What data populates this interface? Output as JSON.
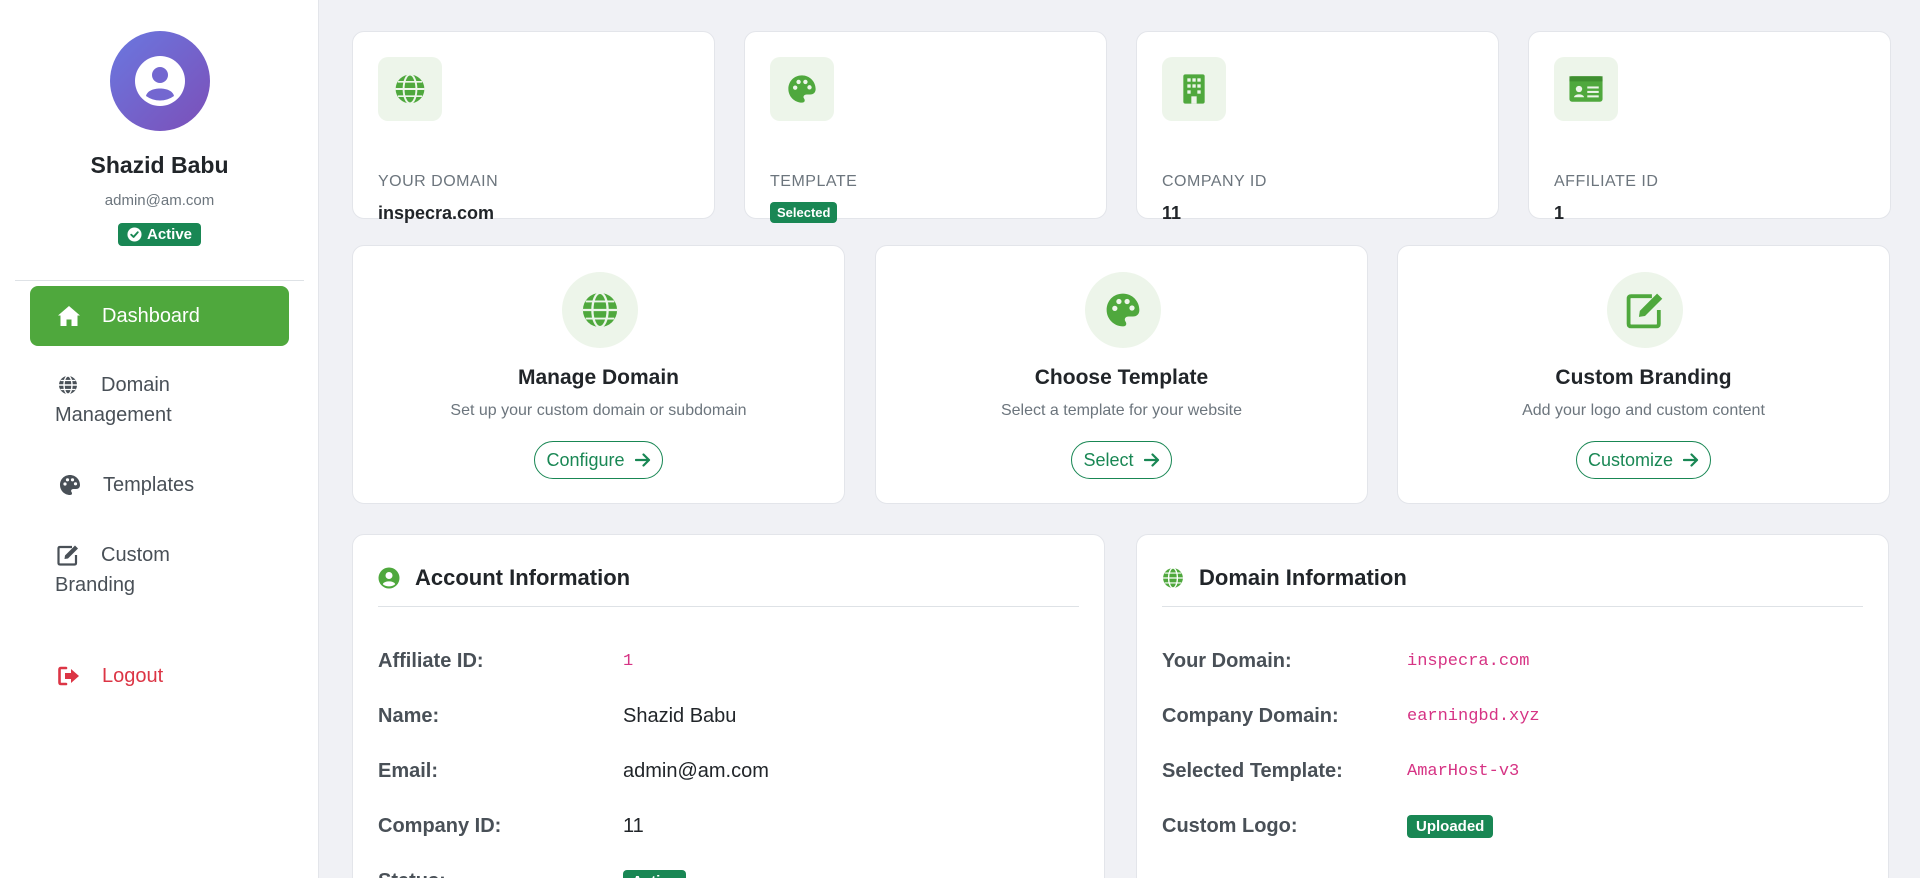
{
  "user": {
    "name": "Shazid Babu",
    "email": "admin@am.com",
    "status": "Active"
  },
  "nav": {
    "dashboard": "Dashboard",
    "domain": "Domain Management",
    "templates": "Templates",
    "branding": "Custom Branding",
    "logout": "Logout"
  },
  "stats": [
    {
      "label": "YOUR DOMAIN",
      "value": "inspecra.com",
      "icon": "globe-icon"
    },
    {
      "label": "TEMPLATE",
      "value": "Selected",
      "icon": "palette-icon"
    },
    {
      "label": "COMPANY ID",
      "value": "11",
      "icon": "building-icon"
    },
    {
      "label": "AFFILIATE ID",
      "value": "1",
      "icon": "id-card-icon"
    }
  ],
  "actions": [
    {
      "title": "Manage Domain",
      "desc": "Set up your custom domain or subdomain",
      "button": "Configure",
      "icon": "globe-icon"
    },
    {
      "title": "Choose Template",
      "desc": "Select a template for your website",
      "button": "Select",
      "icon": "palette-icon"
    },
    {
      "title": "Custom Branding",
      "desc": "Add your logo and custom content",
      "button": "Customize",
      "icon": "edit-icon"
    }
  ],
  "account": {
    "title": "Account Information",
    "rows": [
      {
        "label": "Affiliate ID:",
        "value": "1"
      },
      {
        "label": "Name:",
        "value": "Shazid Babu"
      },
      {
        "label": "Email:",
        "value": "admin@am.com"
      },
      {
        "label": "Company ID:",
        "value": "11"
      },
      {
        "label": "Status:",
        "value": "Active"
      }
    ]
  },
  "domain": {
    "title": "Domain Information",
    "rows": [
      {
        "label": "Your Domain:",
        "value": "inspecra.com"
      },
      {
        "label": "Company Domain:",
        "value": "earningbd.xyz"
      },
      {
        "label": "Selected Template:",
        "value": "AmarHost-v3"
      },
      {
        "label": "Custom Logo:",
        "value": "Uploaded"
      }
    ]
  },
  "colors": {
    "accent": "#4fa83d",
    "success": "#198754",
    "danger": "#dc3545",
    "code": "#d63384"
  }
}
